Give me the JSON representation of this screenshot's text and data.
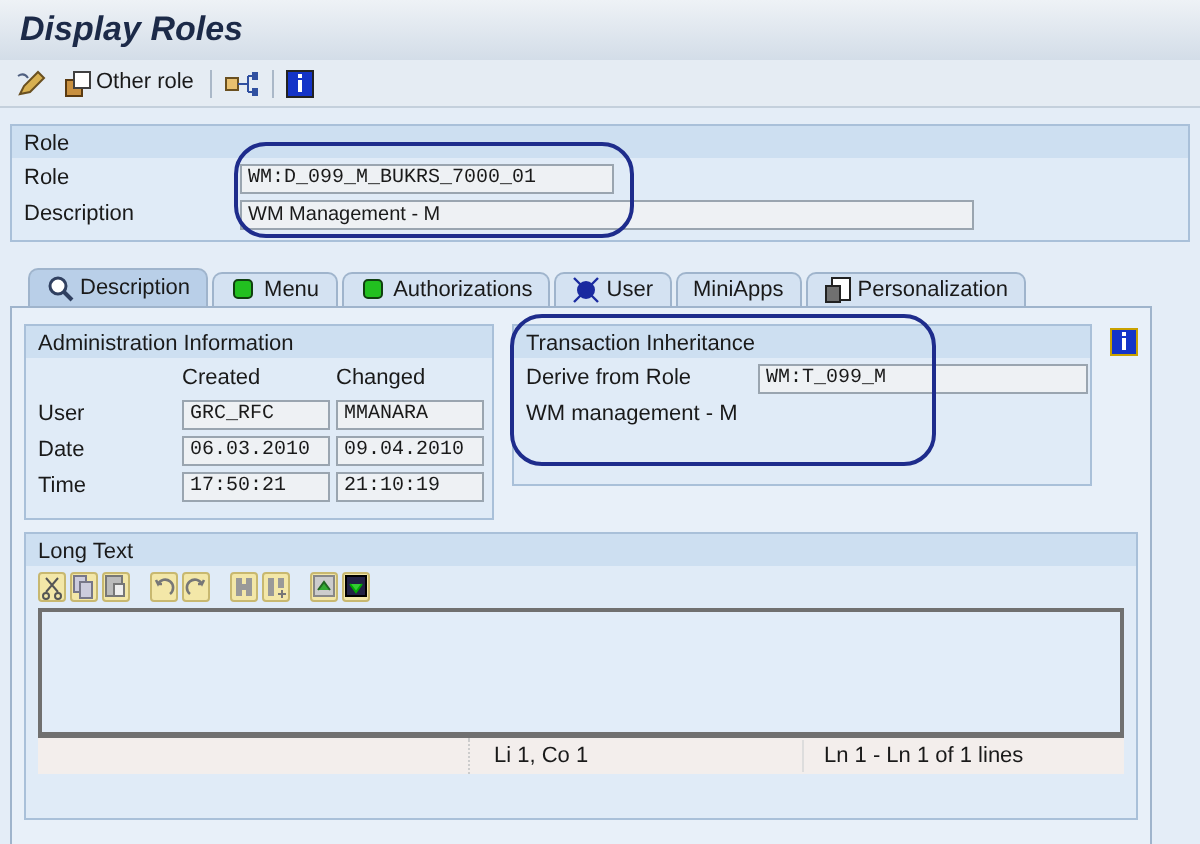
{
  "window": {
    "title": "Display Roles"
  },
  "toolbar": {
    "other_role": "Other role"
  },
  "role": {
    "title": "Role",
    "fields": [
      {
        "label": "Role",
        "value": "WM:D_099_M_BUKRS_7000_01",
        "kind": "short"
      },
      {
        "label": "Description",
        "value": "WM Management - M",
        "kind": "long"
      }
    ]
  },
  "tabs": [
    {
      "label": "Description",
      "kind": "search",
      "selected": true
    },
    {
      "label": "Menu",
      "kind": "status",
      "selected": false
    },
    {
      "label": "Authorizations",
      "kind": "status",
      "selected": false
    },
    {
      "label": "User",
      "kind": "user",
      "selected": false
    },
    {
      "label": "MiniApps",
      "kind": "plain",
      "selected": false
    },
    {
      "label": "Personalization",
      "kind": "personalization",
      "selected": false
    }
  ],
  "admin": {
    "title": "Administration Information",
    "columns": [
      "Created",
      "Changed"
    ],
    "rows": [
      {
        "label": "User",
        "values": [
          "GRC_RFC",
          "MMANARA"
        ]
      },
      {
        "label": "Date",
        "values": [
          "06.03.2010",
          "09.04.2010"
        ]
      },
      {
        "label": "Time",
        "values": [
          "17:50:21",
          "21:10:19"
        ]
      }
    ]
  },
  "inheritance": {
    "title": "Transaction Inheritance",
    "label": "Derive from Role",
    "value": "WM:T_099_M",
    "description": "WM management - M"
  },
  "long_text": {
    "title": "Long Text",
    "position": "Li 1, Co 1",
    "lines": "Ln 1 - Ln 1 of 1 lines"
  }
}
